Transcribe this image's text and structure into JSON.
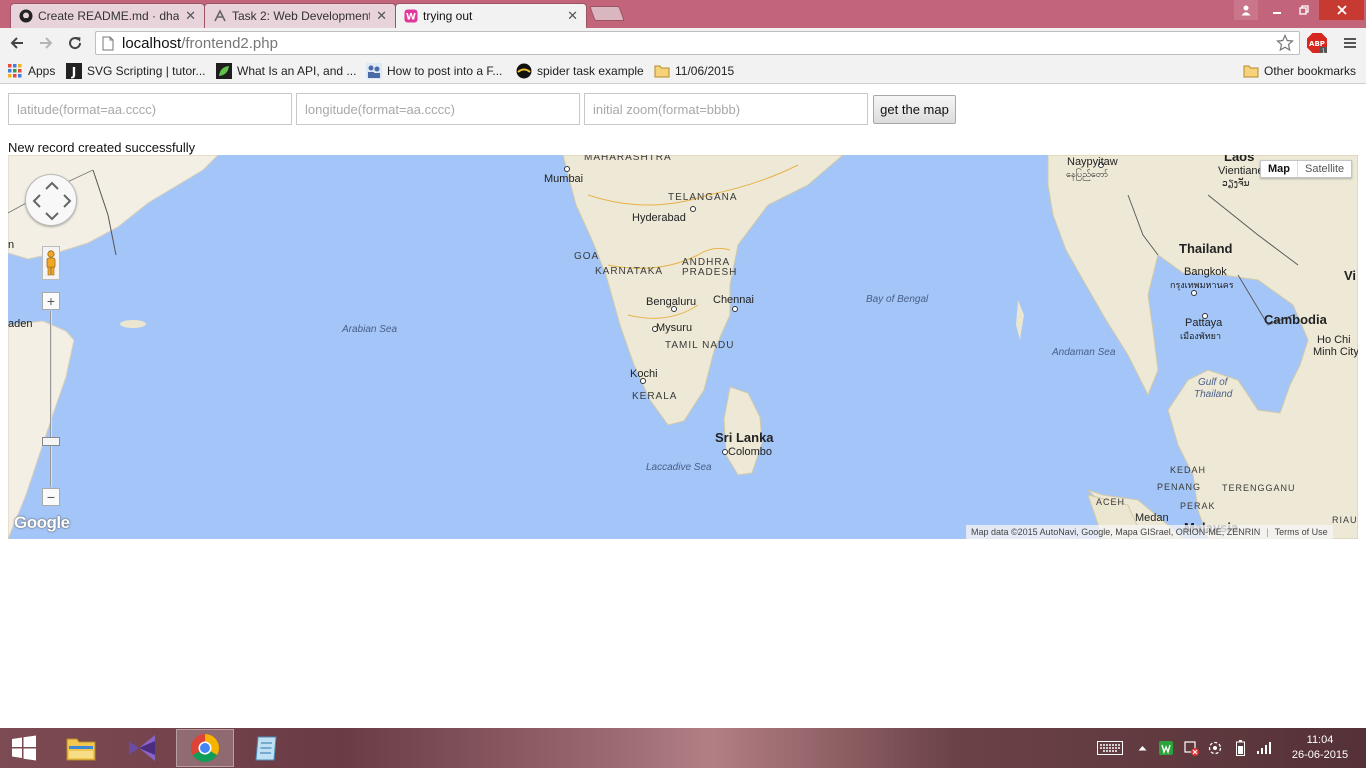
{
  "browser": {
    "tabs": [
      {
        "title": "Create README.md · dhar",
        "icon": "github-icon",
        "active": false
      },
      {
        "title": "Task 2: Web Development",
        "icon": "script-icon",
        "active": false
      },
      {
        "title": "trying out",
        "icon": "wamp-icon",
        "active": true
      }
    ],
    "url_host": "localhost",
    "url_path": "/frontend2.php",
    "extension_badge": "ABP",
    "bookmarks": [
      {
        "label": "Apps",
        "icon": "apps-grid-icon"
      },
      {
        "label": "SVG Scripting | tutor...",
        "icon": "j-icon"
      },
      {
        "label": "What Is an API, and ...",
        "icon": "leaf-icon"
      },
      {
        "label": "How to post into a F...",
        "icon": "people-icon"
      },
      {
        "label": "spider task example",
        "icon": "spider-icon"
      },
      {
        "label": "11/06/2015",
        "icon": "folder-icon"
      }
    ],
    "other_bookmarks": "Other bookmarks"
  },
  "form": {
    "latitude_placeholder": "latitude(format=aa.cccc)",
    "longitude_placeholder": "longitude(format=aa.cccc)",
    "zoom_placeholder": "initial zoom(format=bbbb)",
    "submit_label": "get the map"
  },
  "status_message": "New record created successfully",
  "map": {
    "map_type_active": "Map",
    "map_type_other": "Satellite",
    "logo": "Google",
    "attribution": "Map data ©2015 AutoNavi, Google, Mapa GISrael, ORION-ME, ZENRIN",
    "terms": "Terms of Use",
    "labels": {
      "maharashtra": "MAHARASHTRA",
      "mumbai": "Mumbai",
      "telangana": "TELANGANA",
      "hyderabad": "Hyderabad",
      "goa": "GOA",
      "karnataka": "KARNATAKA",
      "andhra_pradesh_1": "ANDHRA",
      "andhra_pradesh_2": "PRADESH",
      "bengaluru": "Bengaluru",
      "chennai": "Chennai",
      "mysuru": "Mysuru",
      "tamil_nadu": "TAMIL NADU",
      "kochi": "Kochi",
      "kerala": "KERALA",
      "sri_lanka": "Sri Lanka",
      "colombo": "Colombo",
      "laccadive_sea": "Laccadive Sea",
      "arabian_sea": "Arabian Sea",
      "bay_of_bengal": "Bay of Bengal",
      "andaman_sea": "Andaman Sea",
      "naypyitaw": "Naypyitaw",
      "naypyitaw_local": "နေပြည်တော်",
      "laos": "Laos",
      "vientiane": "Vientiane",
      "vientiane_local": "ວຽງຈັນ",
      "thailand": "Thailand",
      "bangkok": "Bangkok",
      "bangkok_local": "กรุงเทพมหานคร",
      "pattaya": "Pattaya",
      "pattaya_local": "เมืองพัทยา",
      "cambodia": "Cambodia",
      "ho_chi_minh_1": "Ho Chi",
      "ho_chi_minh_2": "Minh City",
      "vi": "Vi",
      "gulf_thailand_1": "Gulf of",
      "gulf_thailand_2": "Thailand",
      "kedah": "KEDAH",
      "penang": "PENANG",
      "terengganu": "TERENGGANU",
      "perak": "PERAK",
      "aceh": "ACEH",
      "medan": "Medan",
      "malaysia": "Malaysia",
      "riau": "RIAU",
      "aden": "aden",
      "n_edge": "n"
    }
  },
  "taskbar": {
    "items": [
      {
        "name": "file-explorer-icon"
      },
      {
        "name": "visual-studio-icon"
      },
      {
        "name": "chrome-icon",
        "active": true
      },
      {
        "name": "notepad-icon"
      }
    ],
    "time": "11:04",
    "date": "26-06-2015"
  }
}
